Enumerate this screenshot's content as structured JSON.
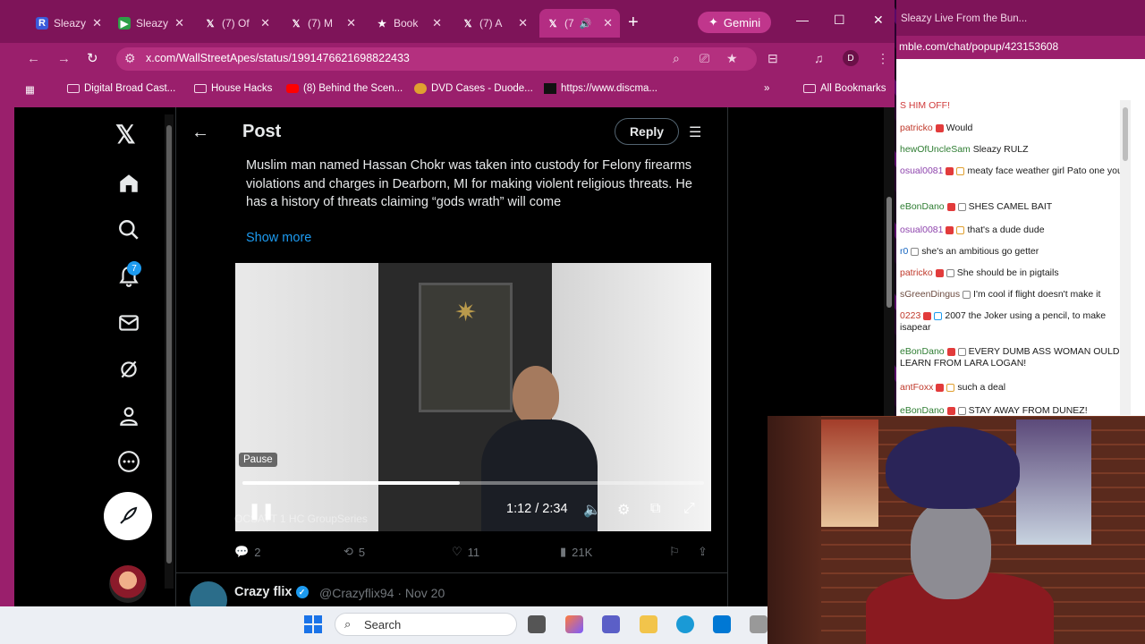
{
  "browser": {
    "tabs": [
      {
        "label": "Sleazy",
        "icon": "rumble-icon",
        "color": "#3b5bdb"
      },
      {
        "label": "Sleazy",
        "icon": "rumble-play-icon",
        "color": "#85bb65"
      },
      {
        "label": "(7) Of",
        "icon": "x-icon",
        "color": "#000000"
      },
      {
        "label": "(7) M",
        "icon": "x-icon",
        "color": "#000000"
      },
      {
        "label": "Book",
        "icon": "star-icon",
        "color": "#000000"
      },
      {
        "label": "(7) A",
        "icon": "x-icon",
        "color": "#000000"
      },
      {
        "label": "(7",
        "icon": "x-icon",
        "color": "#000000"
      }
    ],
    "gemini_label": "Gemini",
    "url": "x.com/WallStreetApes/status/1991476621698822433",
    "profile_initial": "D",
    "bookmarks": [
      {
        "label": "Digital Broad Cast...",
        "icon": "folder-icon"
      },
      {
        "label": "House Hacks",
        "icon": "folder-icon"
      },
      {
        "label": "(8) Behind the Scen...",
        "icon": "youtube-icon"
      },
      {
        "label": "DVD Cases - Duode...",
        "icon": "site-icon"
      },
      {
        "label": "https://www.discma...",
        "icon": "site-icon"
      }
    ],
    "all_bookmarks": "All Bookmarks"
  },
  "x": {
    "notif_count": "7",
    "header_title": "Post",
    "reply_label": "Reply",
    "tweet_text": "Muslim man named Hassan Chokr was taken into custody for Felony firearms violations and charges in Dearborn, MI for making violent religious threats. He has a history of threats claiming “gods wrath” will come",
    "show_more": "Show more",
    "video": {
      "pause_tooltip": "Pause",
      "time": "1:12 / 2:34",
      "progress": 0.47,
      "overlay_text": "OCSATT 1 HC GroupSeries"
    },
    "stats": {
      "replies": "2",
      "reposts": "5",
      "likes": "11",
      "views": "21K"
    },
    "next_post": {
      "author": "Crazy flix",
      "handle": "@Crazyflix94 · Nov 20"
    }
  },
  "chat": {
    "window_title": "Sleazy Live From the Bun...",
    "url": "mble.com/chat/popup/423153608",
    "messages": [
      {
        "user": "",
        "text": "S HIM OFF!"
      },
      {
        "user": "patricko",
        "text": "Would"
      },
      {
        "user": "hewOfUncleSam",
        "text": "Sleazy RULZ"
      },
      {
        "user": "osual0081",
        "text": "meaty face weather girl Pato one you"
      },
      {
        "user": "eBonDano",
        "text": "SHES CAMEL BAIT"
      },
      {
        "user": "osual0081",
        "text": "that's a dude dude"
      },
      {
        "user": "r0",
        "text": "she's an ambitious go getter"
      },
      {
        "user": "patricko",
        "text": "She should be in pigtails"
      },
      {
        "user": "sGreenDingus",
        "text": "I'm cool if flight doesn't make it"
      },
      {
        "user": "0223",
        "text": "2007 the Joker using a pencil, to make isapear"
      },
      {
        "user": "eBonDano",
        "text": "EVERY DUMB ASS WOMAN OULD LEARN FROM LARA LOGAN!"
      },
      {
        "user": "antFoxx",
        "text": "such a deal"
      },
      {
        "user": "eBonDano",
        "text": "STAY AWAY FROM DUNEZ!"
      }
    ]
  },
  "taskbar": {
    "search_placeholder": "Search"
  }
}
